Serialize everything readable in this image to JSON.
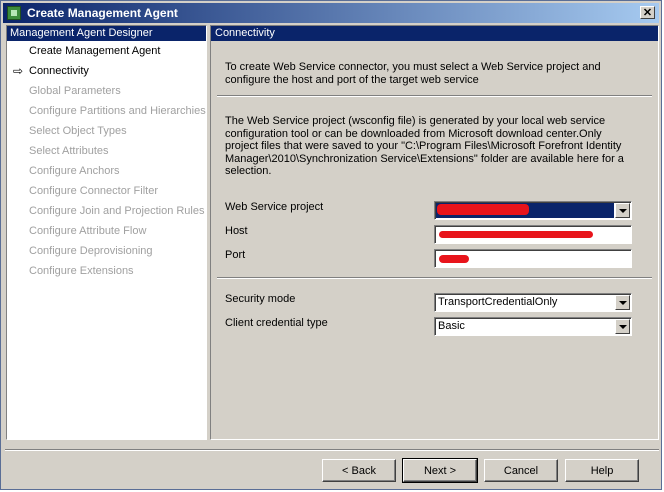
{
  "window": {
    "title": "Create Management Agent",
    "close_label": "✕"
  },
  "sidebar": {
    "header": "Management Agent Designer",
    "items": [
      {
        "label": "Create Management Agent",
        "state": "done"
      },
      {
        "label": "Connectivity",
        "state": "current",
        "marker": "⇨"
      },
      {
        "label": "Global Parameters",
        "state": "pending"
      },
      {
        "label": "Configure Partitions and Hierarchies",
        "state": "pending"
      },
      {
        "label": "Select Object Types",
        "state": "pending"
      },
      {
        "label": "Select Attributes",
        "state": "pending"
      },
      {
        "label": "Configure Anchors",
        "state": "pending"
      },
      {
        "label": "Configure Connector Filter",
        "state": "pending"
      },
      {
        "label": "Configure Join and Projection Rules",
        "state": "pending"
      },
      {
        "label": "Configure Attribute Flow",
        "state": "pending"
      },
      {
        "label": "Configure Deprovisioning",
        "state": "pending"
      },
      {
        "label": "Configure Extensions",
        "state": "pending"
      }
    ]
  },
  "main": {
    "header": "Connectivity",
    "intro": "To create Web Service connector, you must select a Web Service  project and configure the host and port of the target web service",
    "description": "The Web Service project (wsconfig file) is generated by your local web service configuration tool or can be downloaded from Microsoft download center.Only project files that were saved to your \"C:\\Program Files\\Microsoft Forefront Identity Manager\\2010\\Synchronization Service\\Extensions\" folder are available here for a selection.",
    "web_service_project": {
      "label": "Web Service project",
      "value": ""
    },
    "host": {
      "label": "Host",
      "value": ""
    },
    "port": {
      "label": "Port",
      "value": ""
    },
    "security_mode": {
      "label": "Security mode",
      "value": "TransportCredentialOnly"
    },
    "client_credential": {
      "label": "Client credential type",
      "value": "Basic"
    }
  },
  "buttons": {
    "back": "< Back",
    "next": "Next >",
    "cancel": "Cancel",
    "help": "Help"
  },
  "colors": {
    "header_bg": "#0a246a",
    "redaction": "#e8141b",
    "dialog_bg": "#d4d0c8"
  }
}
